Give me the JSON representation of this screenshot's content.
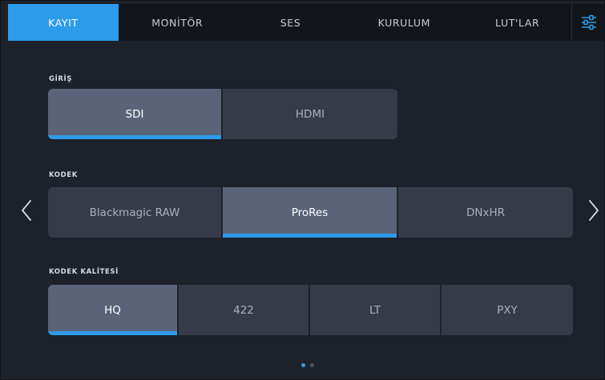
{
  "tabs": [
    {
      "label": "KAYIT",
      "active": true
    },
    {
      "label": "MONİTÖR",
      "active": false
    },
    {
      "label": "SES",
      "active": false
    },
    {
      "label": "KURULUM",
      "active": false
    },
    {
      "label": "LUT'LAR",
      "active": false
    }
  ],
  "settings_icon": "sliders-icon",
  "sections": {
    "input": {
      "label": "GİRİŞ",
      "options": [
        "SDI",
        "HDMI"
      ],
      "selected": "SDI"
    },
    "codec": {
      "label": "KODEK",
      "options": [
        "Blackmagic RAW",
        "ProRes",
        "DNxHR"
      ],
      "selected": "ProRes"
    },
    "codec_quality": {
      "label": "KODEK KALİTESİ",
      "options": [
        "HQ",
        "422",
        "LT",
        "PXY"
      ],
      "selected": "HQ"
    }
  },
  "navigation": {
    "prev_icon": "chevron-left-icon",
    "next_icon": "chevron-right-icon"
  },
  "pager": {
    "pages": 2,
    "current": 1
  },
  "colors": {
    "accent": "#2d9be9",
    "background": "#1d222a",
    "tabbar": "#12151a",
    "option": "#353c48",
    "option_selected": "#5a6378"
  }
}
